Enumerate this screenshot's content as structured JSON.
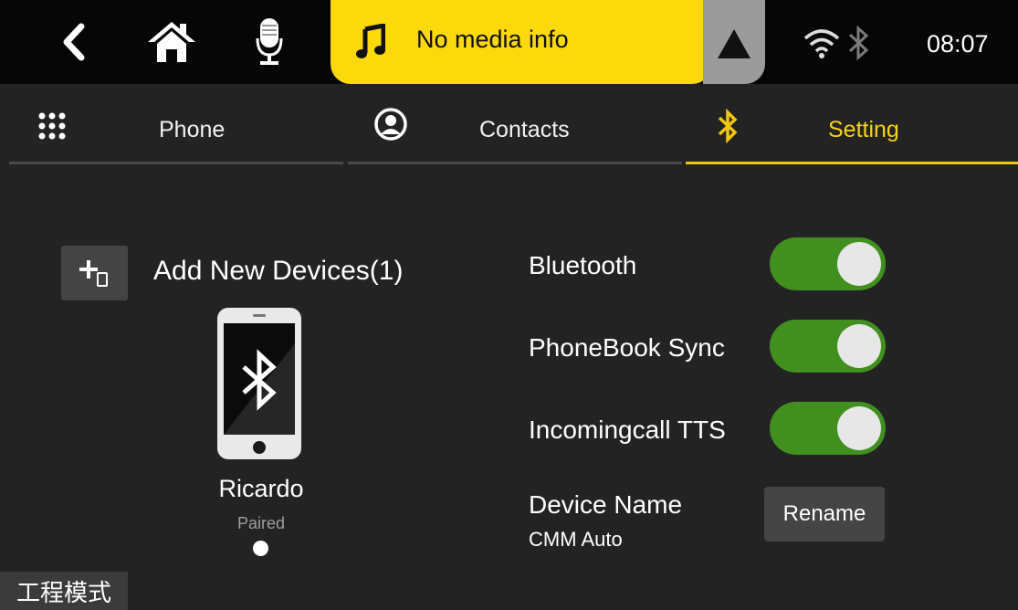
{
  "status_bar": {
    "back_icon": "chevron-left-icon",
    "home_icon": "home-icon",
    "mic_icon": "microphone-icon",
    "media_icon": "music-note-icon",
    "media_text": "No media info",
    "nav_icon": "navigation-arrow-icon",
    "wifi_icon": "wifi-icon",
    "bluetooth_icon": "bluetooth-icon",
    "clock": "08:07"
  },
  "tabs": [
    {
      "icon": "keypad-icon",
      "label": "Phone",
      "active": false
    },
    {
      "icon": "contact-icon",
      "label": "Contacts",
      "active": false
    },
    {
      "icon": "bluetooth-icon",
      "label": "Setting",
      "active": true
    }
  ],
  "devices": {
    "add_icon": "add-device-icon",
    "add_label": "Add New Devices(1)",
    "device_icon": "bluetooth-phone-icon",
    "device_name": "Ricardo",
    "device_status": "Paired"
  },
  "settings": [
    {
      "label": "Bluetooth",
      "on": true
    },
    {
      "label": "PhoneBook Sync",
      "on": true
    },
    {
      "label": "Incomingcall TTS",
      "on": true
    }
  ],
  "device_name": {
    "label": "Device Name",
    "value": "CMM Auto",
    "rename_label": "Rename"
  },
  "engineering_mode": "工程模式",
  "colors": {
    "accent": "#f2c80e",
    "toggle_on": "#41901f",
    "media_bar": "#fcd90a",
    "background": "#232323"
  }
}
